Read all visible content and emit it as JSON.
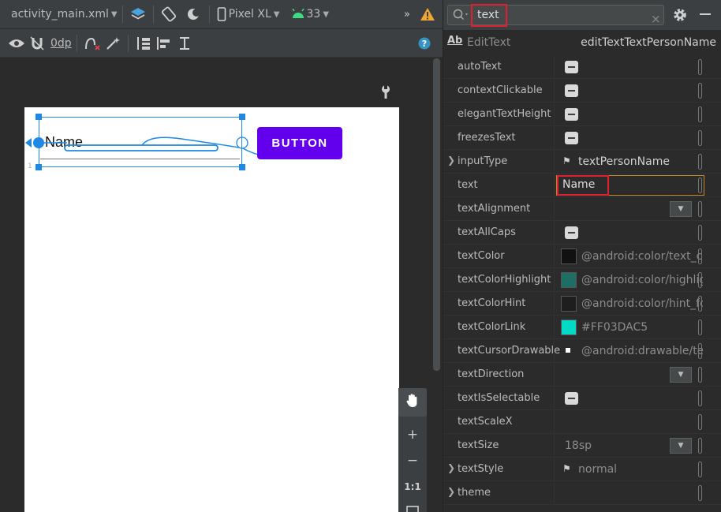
{
  "toolbar": {
    "file_name": "activity_main.xml",
    "device": "Pixel XL",
    "api_level": "33",
    "margin": "0dp"
  },
  "canvas": {
    "edittext_value": "Name",
    "button_label": "BUTTON",
    "button_color": "#6200EE"
  },
  "attributes": {
    "search_value": "text",
    "component_type": "EditText",
    "component_id": "editTextTextPersonName",
    "rows": [
      {
        "name": "autoText",
        "kind": "checkbox"
      },
      {
        "name": "contextClickable",
        "kind": "checkbox"
      },
      {
        "name": "elegantTextHeight",
        "kind": "checkbox"
      },
      {
        "name": "freezesText",
        "kind": "checkbox"
      },
      {
        "name": "inputType",
        "kind": "flag",
        "value": "textPersonName",
        "expandable": true
      },
      {
        "name": "text",
        "kind": "input",
        "value": "Name"
      },
      {
        "name": "textAlignment",
        "kind": "dropdown"
      },
      {
        "name": "textAllCaps",
        "kind": "checkbox"
      },
      {
        "name": "textColor",
        "kind": "color",
        "value": "@android:color/text_cc",
        "swatch": "#111111"
      },
      {
        "name": "textColorHighlight",
        "kind": "color",
        "value": "@android:color/highlig",
        "swatch": "#1f6e64"
      },
      {
        "name": "textColorHint",
        "kind": "color",
        "value": "@android:color/hint_fc",
        "swatch": "#1e1e1e"
      },
      {
        "name": "textColorLink",
        "kind": "color",
        "value": "#FF03DAC5",
        "swatch": "#03dac5"
      },
      {
        "name": "textCursorDrawable",
        "kind": "drawable",
        "value": "@android:drawable/tex"
      },
      {
        "name": "textDirection",
        "kind": "dropdown"
      },
      {
        "name": "textIsSelectable",
        "kind": "checkbox"
      },
      {
        "name": "textScaleX",
        "kind": "empty"
      },
      {
        "name": "textSize",
        "kind": "dropdown-value",
        "value": "18sp"
      },
      {
        "name": "textStyle",
        "kind": "flag",
        "value": "normal",
        "expandable": true
      },
      {
        "name": "theme",
        "kind": "empty",
        "expandable": true
      }
    ]
  }
}
